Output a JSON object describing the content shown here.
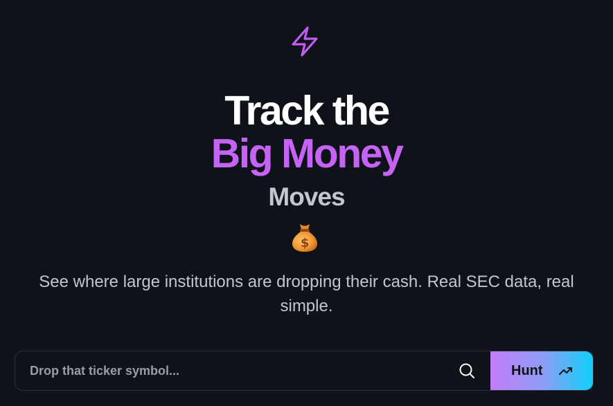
{
  "hero": {
    "line1": "Track the",
    "line2": "Big Money",
    "line3": "Moves",
    "subtitle_line1": "See where large institutions are dropping their cash. Real SEC data, real",
    "subtitle_line2": "simple."
  },
  "icons": {
    "logo": "lightning-bolt-icon",
    "emoji": "money-bag-icon",
    "search": "search-icon",
    "trend": "trending-up-icon"
  },
  "search": {
    "placeholder": "Drop that ticker symbol...",
    "value": "",
    "button_label": "Hunt"
  },
  "colors": {
    "background": "#10121a",
    "accent_purple": "#c563f4",
    "button_gradient_start": "#c37cf9",
    "button_gradient_end": "#10d0f9"
  }
}
